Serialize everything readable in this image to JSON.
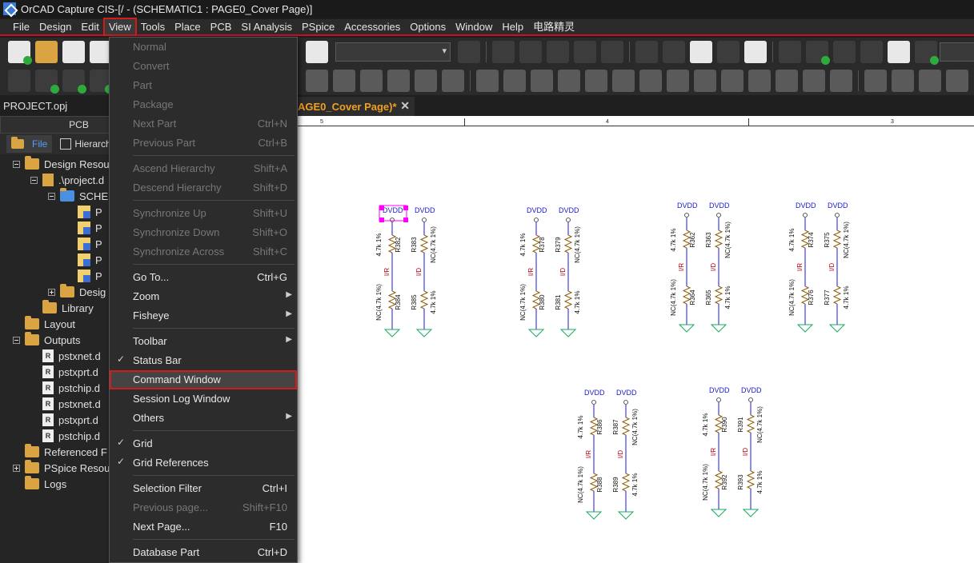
{
  "titlebar": {
    "title": "OrCAD Capture CIS-[/ - (SCHEMATIC1 : PAGE0_Cover Page)]"
  },
  "menubar": {
    "items": [
      "File",
      "Design",
      "Edit",
      "View",
      "Tools",
      "Place",
      "PCB",
      "SI Analysis",
      "PSpice",
      "Accessories",
      "Options",
      "Window",
      "Help",
      "电路精灵"
    ]
  },
  "project": {
    "name": "PROJECT.opj"
  },
  "tab": {
    "title": "AGE0_Cover Page)*",
    "close": "✕"
  },
  "panel": {
    "header": "PCB",
    "tabs": [
      "File",
      "Hierarchy"
    ],
    "tree": [
      {
        "label": "Design Resou",
        "level": 1,
        "type": "folder",
        "exp": "minus"
      },
      {
        "label": ".\\project.d",
        "level": 2,
        "type": "check",
        "exp": "minus"
      },
      {
        "label": "SCHE",
        "level": 3,
        "type": "folder-blue",
        "exp": "minus"
      },
      {
        "label": "P",
        "level": 4,
        "type": "page"
      },
      {
        "label": "P",
        "level": 4,
        "type": "page"
      },
      {
        "label": "P",
        "level": 4,
        "type": "page"
      },
      {
        "label": "P",
        "level": 4,
        "type": "page"
      },
      {
        "label": "P",
        "level": 4,
        "type": "page"
      },
      {
        "label": "Desig",
        "level": 3,
        "type": "folder",
        "exp": "plus"
      },
      {
        "label": "Library",
        "level": 2,
        "type": "folder"
      },
      {
        "label": "Layout",
        "level": 1,
        "type": "folder"
      },
      {
        "label": "Outputs",
        "level": 1,
        "type": "folder",
        "exp": "minus"
      },
      {
        "label": "pstxnet.d",
        "level": 2,
        "type": "doc"
      },
      {
        "label": "pstxprt.d",
        "level": 2,
        "type": "doc"
      },
      {
        "label": "pstchip.d",
        "level": 2,
        "type": "doc"
      },
      {
        "label": "pstxnet.d",
        "level": 2,
        "type": "doc"
      },
      {
        "label": "pstxprt.d",
        "level": 2,
        "type": "doc"
      },
      {
        "label": "pstchip.d",
        "level": 2,
        "type": "doc"
      },
      {
        "label": "Referenced F",
        "level": 1,
        "type": "folder"
      },
      {
        "label": "PSpice Resou",
        "level": 1,
        "type": "folder",
        "exp": "plus"
      },
      {
        "label": "Logs",
        "level": 1,
        "type": "folder"
      }
    ]
  },
  "view_menu": {
    "items": [
      {
        "label": "Normal",
        "shortcut": "",
        "disabled": true,
        "check": false,
        "arrow": false,
        "sep_after": false
      },
      {
        "label": "Convert",
        "shortcut": "",
        "disabled": true,
        "check": false,
        "arrow": false,
        "sep_after": false
      },
      {
        "label": "Part",
        "shortcut": "",
        "disabled": true,
        "check": false,
        "arrow": false,
        "sep_after": false
      },
      {
        "label": "Package",
        "shortcut": "",
        "disabled": true,
        "check": false,
        "arrow": false,
        "sep_after": false
      },
      {
        "label": "Next Part",
        "shortcut": "Ctrl+N",
        "disabled": true,
        "check": false,
        "arrow": false,
        "sep_after": false
      },
      {
        "label": "Previous Part",
        "shortcut": "Ctrl+B",
        "disabled": true,
        "check": false,
        "arrow": false,
        "sep_after": true
      },
      {
        "label": "Ascend Hierarchy",
        "shortcut": "Shift+A",
        "disabled": true,
        "check": false,
        "arrow": false,
        "sep_after": false
      },
      {
        "label": "Descend Hierarchy",
        "shortcut": "Shift+D",
        "disabled": true,
        "check": false,
        "arrow": false,
        "sep_after": true
      },
      {
        "label": "Synchronize Up",
        "shortcut": "Shift+U",
        "disabled": true,
        "check": false,
        "arrow": false,
        "sep_after": false
      },
      {
        "label": "Synchronize Down",
        "shortcut": "Shift+O",
        "disabled": true,
        "check": false,
        "arrow": false,
        "sep_after": false
      },
      {
        "label": "Synchronize Across",
        "shortcut": "Shift+C",
        "disabled": true,
        "check": false,
        "arrow": false,
        "sep_after": true
      },
      {
        "label": "Go To...",
        "shortcut": "Ctrl+G",
        "disabled": false,
        "check": false,
        "arrow": false,
        "sep_after": false
      },
      {
        "label": "Zoom",
        "shortcut": "",
        "disabled": false,
        "check": false,
        "arrow": true,
        "sep_after": false
      },
      {
        "label": "Fisheye",
        "shortcut": "",
        "disabled": false,
        "check": false,
        "arrow": true,
        "sep_after": true
      },
      {
        "label": "Toolbar",
        "shortcut": "",
        "disabled": false,
        "check": false,
        "arrow": true,
        "sep_after": false
      },
      {
        "label": "Status Bar",
        "shortcut": "",
        "disabled": false,
        "check": true,
        "arrow": false,
        "sep_after": false
      },
      {
        "label": "Command Window",
        "shortcut": "",
        "disabled": false,
        "check": false,
        "arrow": false,
        "sep_after": false,
        "highlight": true
      },
      {
        "label": "Session Log Window",
        "shortcut": "",
        "disabled": false,
        "check": false,
        "arrow": false,
        "sep_after": false
      },
      {
        "label": "Others",
        "shortcut": "",
        "disabled": false,
        "check": false,
        "arrow": true,
        "sep_after": true
      },
      {
        "label": "Grid",
        "shortcut": "",
        "disabled": false,
        "check": true,
        "arrow": false,
        "sep_after": false
      },
      {
        "label": "Grid References",
        "shortcut": "",
        "disabled": false,
        "check": true,
        "arrow": false,
        "sep_after": true
      },
      {
        "label": "Selection Filter",
        "shortcut": "Ctrl+I",
        "disabled": false,
        "check": false,
        "arrow": false,
        "sep_after": false
      },
      {
        "label": "Previous page...",
        "shortcut": "Shift+F10",
        "disabled": true,
        "check": false,
        "arrow": false,
        "sep_after": false
      },
      {
        "label": "Next Page...",
        "shortcut": "F10",
        "disabled": false,
        "check": false,
        "arrow": false,
        "sep_after": true
      },
      {
        "label": "Database Part",
        "shortcut": "Ctrl+D",
        "disabled": false,
        "check": false,
        "arrow": false,
        "sep_after": false
      }
    ]
  },
  "ruler": {
    "marks": [
      "5",
      "4",
      "3"
    ]
  },
  "schematic": {
    "power_label": "DVDD",
    "net_left": "I/R",
    "net_right": "I/D",
    "groups": [
      {
        "left": {
          "top_ref": "R382",
          "top_val": "4.7k 1%",
          "bot_ref": "R384",
          "bot_val": "NC(4.7k 1%)"
        },
        "right": {
          "top_ref": "R383",
          "top_val": "NC(4.7k 1%)",
          "bot_ref": "R385",
          "bot_val": "4.7k 1%"
        },
        "selected": true
      },
      {
        "left": {
          "top_ref": "R378",
          "top_val": "4.7k 1%",
          "bot_ref": "R380",
          "bot_val": "NC(4.7k 1%)"
        },
        "right": {
          "top_ref": "R379",
          "top_val": "NC(4.7k 1%)",
          "bot_ref": "R381",
          "bot_val": "4.7k 1%"
        },
        "selected": false
      },
      {
        "left": {
          "top_ref": "R362",
          "top_val": "4.7k 1%",
          "bot_ref": "R364",
          "bot_val": "NC(4.7k 1%)"
        },
        "right": {
          "top_ref": "R363",
          "top_val": "NC(4.7k 1%)",
          "bot_ref": "R365",
          "bot_val": "4.7k 1%"
        },
        "selected": false
      },
      {
        "left": {
          "top_ref": "R374",
          "top_val": "4.7k 1%",
          "bot_ref": "R376",
          "bot_val": "NC(4.7k 1%)"
        },
        "right": {
          "top_ref": "R375",
          "top_val": "NC(4.7k 1%)",
          "bot_ref": "R377",
          "bot_val": "4.7k 1%"
        },
        "selected": false
      },
      {
        "left": {
          "top_ref": "R386",
          "top_val": "4.7k 1%",
          "bot_ref": "R388",
          "bot_val": "NC(4.7k 1%)"
        },
        "right": {
          "top_ref": "R387",
          "top_val": "NC(4.7k 1%)",
          "bot_ref": "R389",
          "bot_val": "4.7k 1%"
        },
        "selected": false
      },
      {
        "left": {
          "top_ref": "R390",
          "top_val": "4.7k 1%",
          "bot_ref": "R392",
          "bot_val": "NC(4.7k 1%)"
        },
        "right": {
          "top_ref": "R391",
          "top_val": "NC(4.7k 1%)",
          "bot_ref": "R393",
          "bot_val": "4.7k 1%"
        },
        "selected": false
      }
    ]
  },
  "colors": {
    "accent_red": "#d01c1c",
    "tab_text": "#f0a020",
    "power": "#1a1acc",
    "net": "#b00010",
    "resistor": "#8b5a00",
    "ground": "#1aaa60"
  }
}
